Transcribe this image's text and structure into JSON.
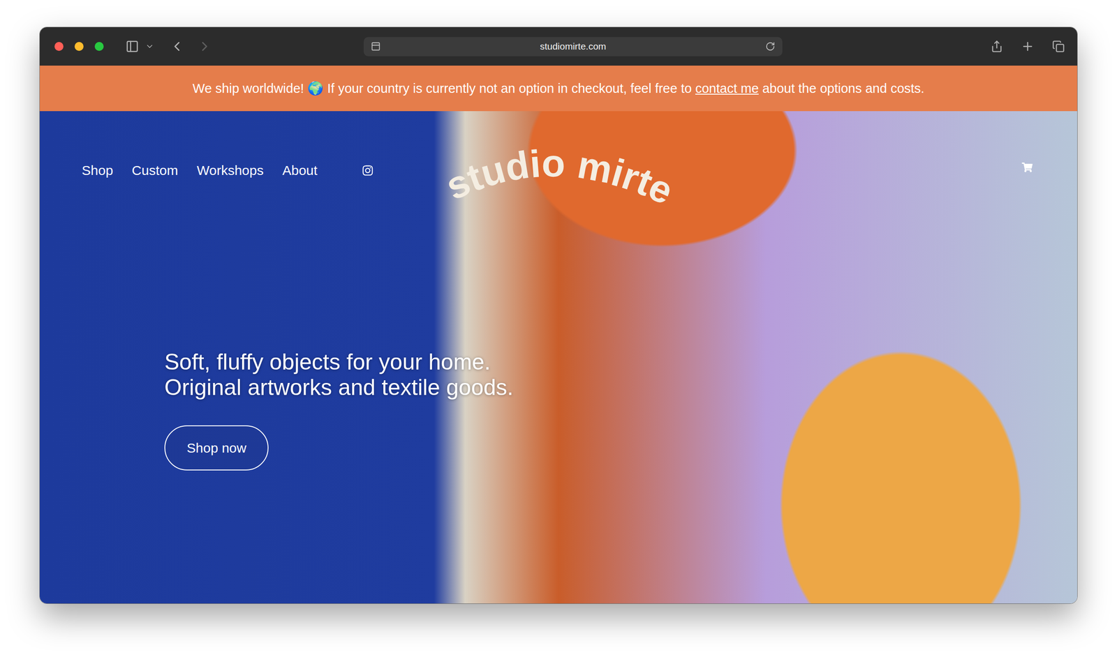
{
  "browser": {
    "url": "studiomirte.com"
  },
  "banner": {
    "text_before": "We ship worldwide! 🌍 If your country is currently not an option in checkout, feel free to",
    "link": "contact me",
    "text_after": "about the options and costs."
  },
  "nav": {
    "items": [
      {
        "label": "Shop"
      },
      {
        "label": "Custom"
      },
      {
        "label": "Workshops"
      },
      {
        "label": "About"
      }
    ]
  },
  "logo": "studio mirte",
  "hero": {
    "lines": [
      "Soft, fluffy objects for your home.",
      "Original artworks and textile goods."
    ],
    "button": "Shop now"
  }
}
